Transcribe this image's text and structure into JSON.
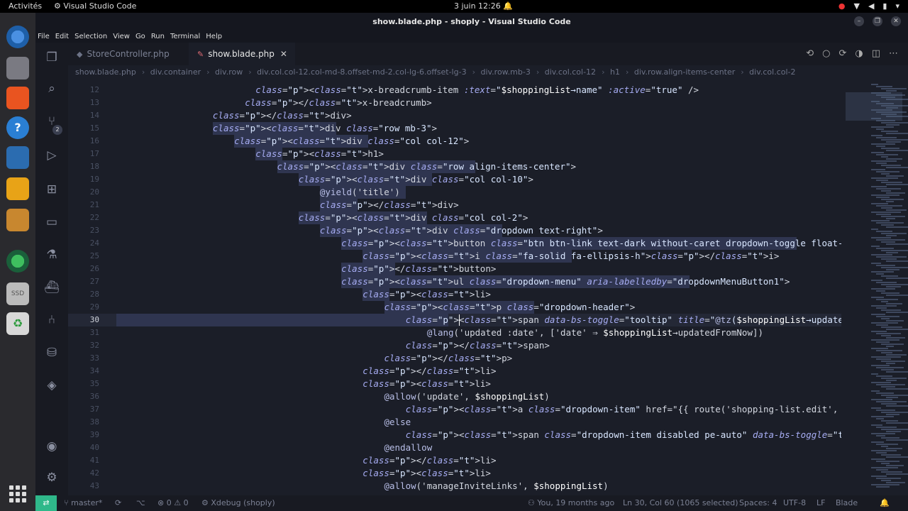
{
  "topbar": {
    "activities": "Activités",
    "app": "Visual Studio Code",
    "clock": "3 juin  12:26"
  },
  "window": {
    "title": "show.blade.php - shoply - Visual Studio Code"
  },
  "menu": [
    "File",
    "Edit",
    "Selection",
    "View",
    "Go",
    "Run",
    "Terminal",
    "Help"
  ],
  "activity": {
    "scm_badge": "2"
  },
  "tabs": [
    {
      "label": "StoreController.php",
      "active": false
    },
    {
      "label": "show.blade.php",
      "active": true,
      "close": "✕"
    }
  ],
  "breadcrumb": [
    "show.blade.php",
    "div.container",
    "div.row",
    "div.col.col-12.col-md-8.offset-md-2.col-lg-6.offset-lg-3",
    "div.row.mb-3",
    "div.col.col-12",
    "h1",
    "div.row.align-items-center",
    "div.col.col-2"
  ],
  "editor": {
    "current_line": "30",
    "lines": [
      {
        "n": "12"
      },
      {
        "n": "13"
      },
      {
        "n": "14"
      },
      {
        "n": "15"
      },
      {
        "n": "16"
      },
      {
        "n": "17"
      },
      {
        "n": "18"
      },
      {
        "n": "19"
      },
      {
        "n": "20"
      },
      {
        "n": "21"
      },
      {
        "n": "22"
      },
      {
        "n": "23"
      },
      {
        "n": "24"
      },
      {
        "n": "25"
      },
      {
        "n": "26"
      },
      {
        "n": "27"
      },
      {
        "n": "28"
      },
      {
        "n": "29"
      },
      {
        "n": "30"
      },
      {
        "n": "31"
      },
      {
        "n": "32"
      },
      {
        "n": "33"
      },
      {
        "n": "34"
      },
      {
        "n": "35"
      },
      {
        "n": "36"
      },
      {
        "n": "37"
      },
      {
        "n": "38"
      },
      {
        "n": "39"
      },
      {
        "n": "40"
      },
      {
        "n": "41"
      },
      {
        "n": "42"
      },
      {
        "n": "43"
      }
    ],
    "code": [
      "<x-breadcrumb-item :text=\"$shoppingList→name\" :active=\"true\" />",
      "</x-breadcrumb>",
      "</div>",
      "<div class=\"row mb-3\">",
      "<div class=\"col col-12\">",
      "<h1>",
      "<div class=\"row align-items-center\">",
      "<div class=\"col col-10\">",
      "@yield('title')",
      "</div>",
      "<div class=\"col col-2\">",
      "<div class=\"dropdown text-right\">",
      "<button class=\"btn btn-link text-dark without-caret dropdown-toggle float-end\" type=",
      "<i class=\"fa-solid fa-ellipsis-h\"></i>",
      "</button>",
      "<ul class=\"dropdown-menu\" aria-labelledby=\"dropdownMenuButton1\">",
      "<li>",
      "<p class=\"dropdown-header\">",
      "<span data-bs-toggle=\"tooltip\" title=\"@tz($shoppingList→updated_at)\">",
      "@lang('updated :date', ['date' ⇒ $shoppingList→updatedFromNow])",
      "</span>",
      "</p>",
      "</li>",
      "<li>",
      "@allow('update', $shoppingList)",
      "<a class=\"dropdown-item\" href=\"{{ route('shopping-list.edit', $shoppingL",
      "@else",
      "<span class=\"dropdown-item disabled pe-auto\" data-bs-toggle=\"tooltip\" ti",
      "@endallow",
      "</li>",
      "<li>",
      "@allow('manageInviteLinks', $shoppingList)"
    ]
  },
  "status": {
    "branch": "master*",
    "problems": "⊗ 0 ⚠ 0",
    "xdebug": "Xdebug (shoply)",
    "blame": "You, 19 months ago",
    "position": "Ln 30, Col 60 (1065 selected)",
    "spaces": "Spaces: 4",
    "encoding": "UTF-8",
    "eol": "LF",
    "language": "Blade"
  },
  "colors": {
    "accent": "#2fb88a",
    "editor_bg": "#1b1e28",
    "selection": "#2f3550"
  }
}
